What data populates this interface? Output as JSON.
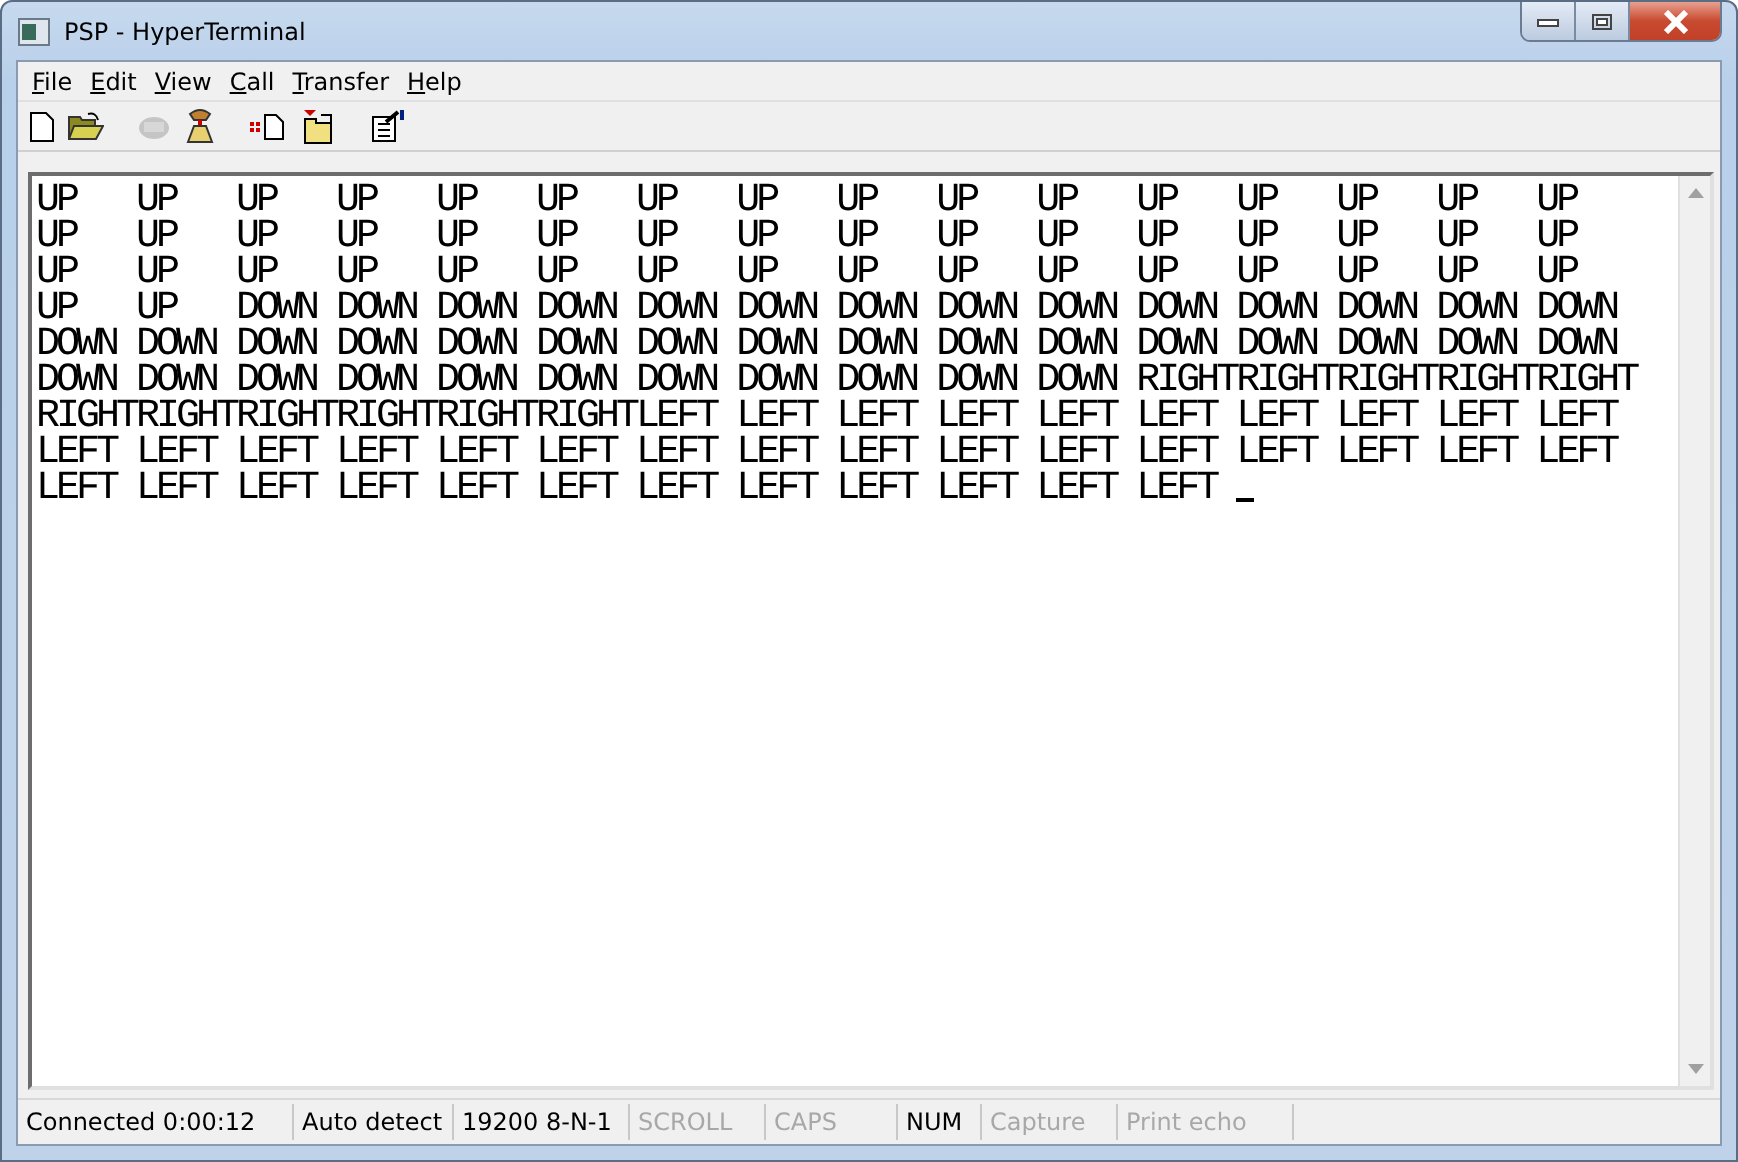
{
  "window": {
    "title": "PSP - HyperTerminal"
  },
  "menu": [
    "File",
    "Edit",
    "View",
    "Call",
    "Transfer",
    "Help"
  ],
  "toolbar": [
    {
      "kind": "new",
      "disabled": false
    },
    {
      "kind": "open",
      "disabled": false
    },
    {
      "kind": "connect",
      "disabled": true
    },
    {
      "kind": "disconnect",
      "disabled": false
    },
    {
      "kind": "send",
      "disabled": false
    },
    {
      "kind": "receive",
      "disabled": false
    },
    {
      "kind": "properties",
      "disabled": false
    }
  ],
  "terminal": {
    "lines": [
      "UP   UP   UP   UP   UP   UP   UP   UP   UP   UP   UP   UP   UP   UP   UP   UP",
      "UP   UP   UP   UP   UP   UP   UP   UP   UP   UP   UP   UP   UP   UP   UP   UP",
      "UP   UP   UP   UP   UP   UP   UP   UP   UP   UP   UP   UP   UP   UP   UP   UP",
      "UP   UP   DOWN DOWN DOWN DOWN DOWN DOWN DOWN DOWN DOWN DOWN DOWN DOWN DOWN DOWN",
      "DOWN DOWN DOWN DOWN DOWN DOWN DOWN DOWN DOWN DOWN DOWN DOWN DOWN DOWN DOWN DOWN",
      "DOWN DOWN DOWN DOWN DOWN DOWN DOWN DOWN DOWN DOWN DOWN RIGHTRIGHTRIGHTRIGHTRIGHT",
      "RIGHTRIGHTRIGHTRIGHTRIGHTRIGHTLEFT LEFT LEFT LEFT LEFT LEFT LEFT LEFT LEFT LEFT",
      "LEFT LEFT LEFT LEFT LEFT LEFT LEFT LEFT LEFT LEFT LEFT LEFT LEFT LEFT LEFT LEFT",
      "LEFT LEFT LEFT LEFT LEFT LEFT LEFT LEFT LEFT LEFT LEFT LEFT"
    ],
    "cursor_visible": true
  },
  "status_bar": [
    {
      "text": "Connected 0:00:12",
      "enabled": true
    },
    {
      "text": "Auto detect",
      "enabled": true
    },
    {
      "text": "19200 8-N-1",
      "enabled": true
    },
    {
      "text": "SCROLL",
      "enabled": false
    },
    {
      "text": "CAPS",
      "enabled": false
    },
    {
      "text": "NUM",
      "enabled": true
    },
    {
      "text": "Capture",
      "enabled": false
    },
    {
      "text": "Print echo",
      "enabled": false
    }
  ]
}
